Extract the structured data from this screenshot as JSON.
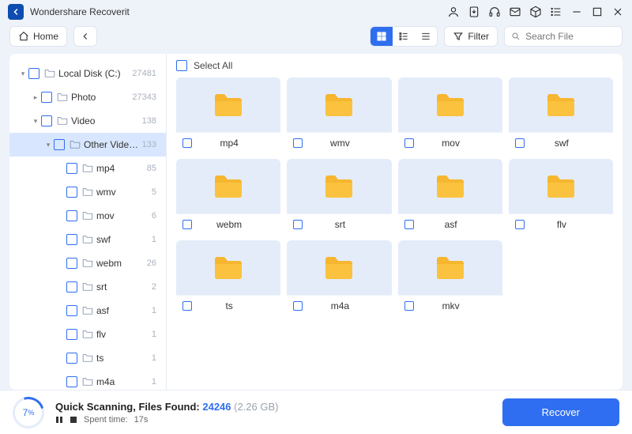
{
  "app": {
    "title": "Wondershare Recoverit"
  },
  "toolbar": {
    "home_label": "Home",
    "filter_label": "Filter",
    "search_placeholder": "Search File"
  },
  "sidebar": {
    "items": [
      {
        "label": "Local Disk (C:)",
        "count": "27481",
        "indent": 0,
        "caret": "▾",
        "active": false
      },
      {
        "label": "Photo",
        "count": "27343",
        "indent": 1,
        "caret": "▸",
        "active": false
      },
      {
        "label": "Video",
        "count": "138",
        "indent": 1,
        "caret": "▾",
        "active": false
      },
      {
        "label": "Other Videos",
        "count": "133",
        "indent": 2,
        "caret": "▾",
        "active": true
      },
      {
        "label": "mp4",
        "count": "85",
        "indent": 3,
        "caret": "",
        "active": false
      },
      {
        "label": "wmv",
        "count": "5",
        "indent": 3,
        "caret": "",
        "active": false
      },
      {
        "label": "mov",
        "count": "6",
        "indent": 3,
        "caret": "",
        "active": false
      },
      {
        "label": "swf",
        "count": "1",
        "indent": 3,
        "caret": "",
        "active": false
      },
      {
        "label": "webm",
        "count": "26",
        "indent": 3,
        "caret": "",
        "active": false
      },
      {
        "label": "srt",
        "count": "2",
        "indent": 3,
        "caret": "",
        "active": false
      },
      {
        "label": "asf",
        "count": "1",
        "indent": 3,
        "caret": "",
        "active": false
      },
      {
        "label": "flv",
        "count": "1",
        "indent": 3,
        "caret": "",
        "active": false
      },
      {
        "label": "ts",
        "count": "1",
        "indent": 3,
        "caret": "",
        "active": false
      },
      {
        "label": "m4a",
        "count": "1",
        "indent": 3,
        "caret": "",
        "active": false
      }
    ]
  },
  "content": {
    "select_all_label": "Select All",
    "folders": [
      {
        "name": "mp4"
      },
      {
        "name": "wmv"
      },
      {
        "name": "mov"
      },
      {
        "name": "swf"
      },
      {
        "name": "webm"
      },
      {
        "name": "srt"
      },
      {
        "name": "asf"
      },
      {
        "name": "flv"
      },
      {
        "name": "ts"
      },
      {
        "name": "m4a"
      },
      {
        "name": "mkv"
      }
    ]
  },
  "status": {
    "percent": "7",
    "percent_suffix": "%",
    "label": "Quick Scanning, Files Found: ",
    "found": "24246",
    "size": "(2.26 GB)",
    "spent_label": "Spent time:",
    "spent_value": "17s",
    "recover_label": "Recover"
  }
}
